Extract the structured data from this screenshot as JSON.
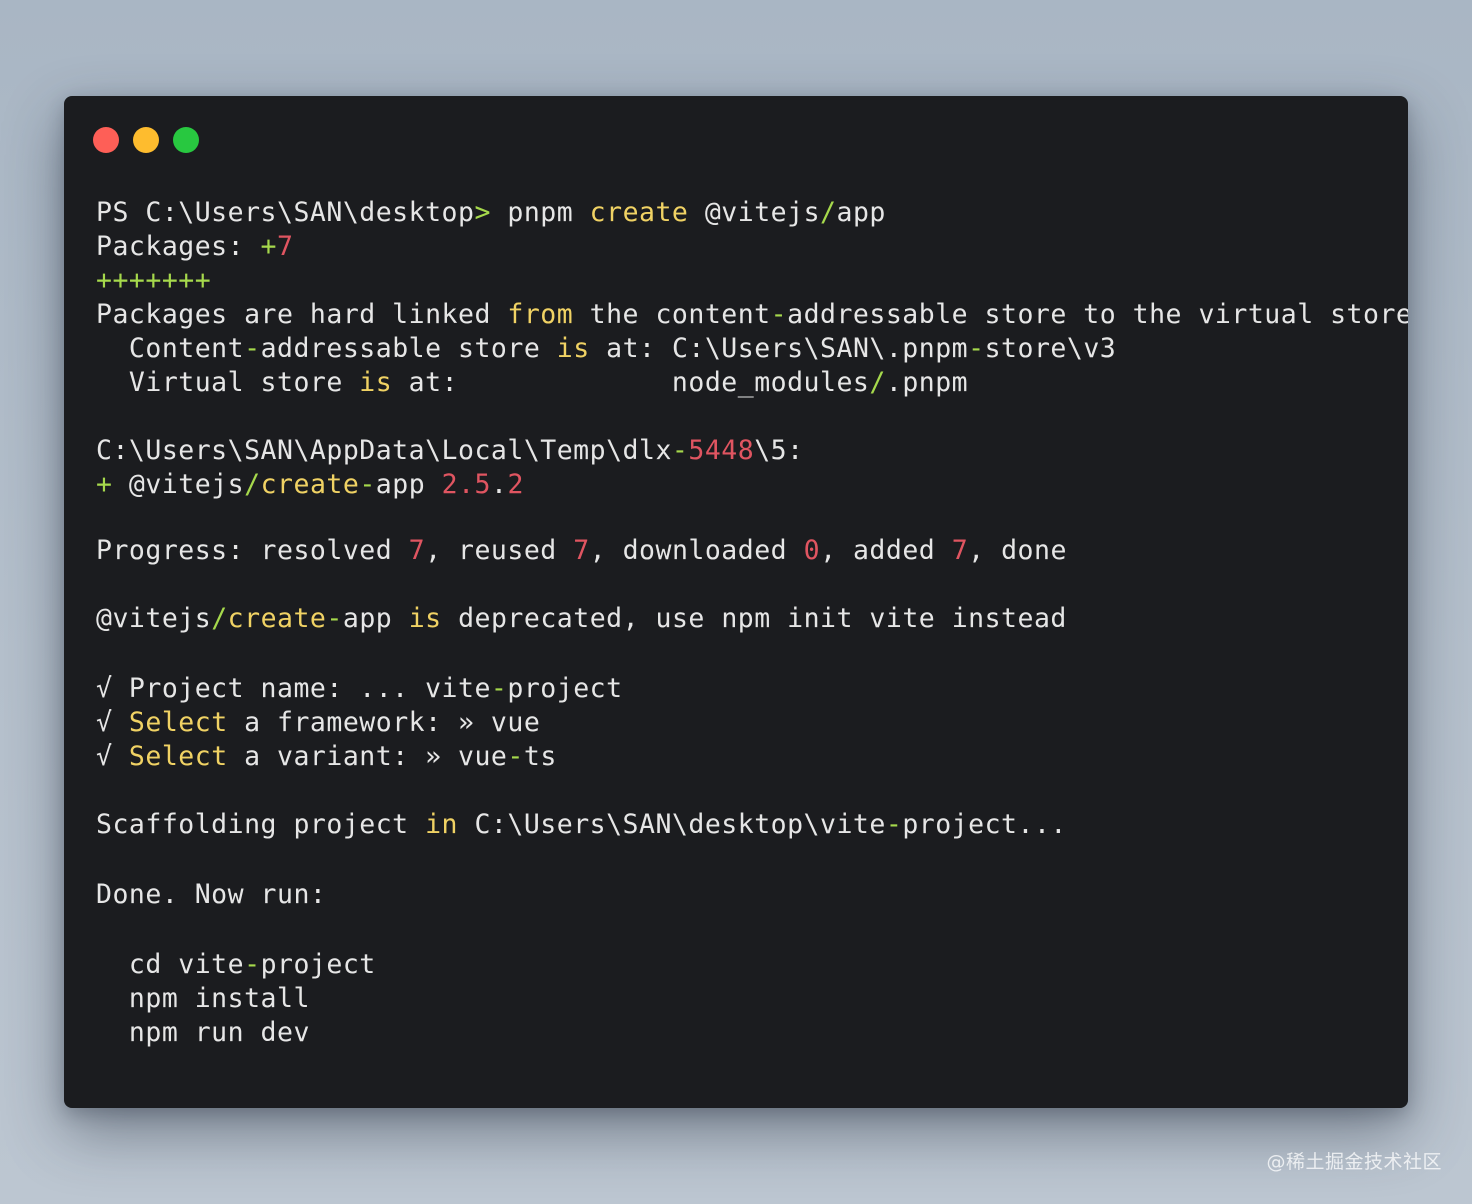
{
  "colors": {
    "background": "#b2bdc9",
    "window": "#1b1c1f",
    "text": "#e6e6e6",
    "keyword": "#f0d264",
    "operator": "#a6d94c",
    "number": "#e05561",
    "dot_close": "#fe5f57",
    "dot_minimize": "#febc2e",
    "dot_maximize": "#28c840"
  },
  "window_controls": [
    "close",
    "minimize",
    "maximize"
  ],
  "terminal": {
    "lines": [
      {
        "gap_before": 0,
        "segments": [
          {
            "t": "PS C:\\Users\\SAN\\desktop",
            "c": "text"
          },
          {
            "t": ">",
            "c": "operator"
          },
          {
            "t": " pnpm ",
            "c": "text"
          },
          {
            "t": "create",
            "c": "keyword"
          },
          {
            "t": " @vitejs",
            "c": "text"
          },
          {
            "t": "/",
            "c": "operator"
          },
          {
            "t": "app",
            "c": "text"
          }
        ]
      },
      {
        "gap_before": 0,
        "segments": [
          {
            "t": "Packages: ",
            "c": "text"
          },
          {
            "t": "+",
            "c": "operator"
          },
          {
            "t": "7",
            "c": "number"
          }
        ]
      },
      {
        "gap_before": 0,
        "segments": [
          {
            "t": "+++++++",
            "c": "operator"
          }
        ]
      },
      {
        "gap_before": 0,
        "segments": [
          {
            "t": "Packages are hard linked ",
            "c": "text"
          },
          {
            "t": "from",
            "c": "keyword"
          },
          {
            "t": " the content",
            "c": "text"
          },
          {
            "t": "-",
            "c": "operator"
          },
          {
            "t": "addressable store to the virtual store.",
            "c": "text"
          }
        ]
      },
      {
        "gap_before": 0,
        "segments": [
          {
            "t": "  Content",
            "c": "text"
          },
          {
            "t": "-",
            "c": "operator"
          },
          {
            "t": "addressable store ",
            "c": "text"
          },
          {
            "t": "is",
            "c": "keyword"
          },
          {
            "t": " at: C:\\Users\\SAN\\.pnpm",
            "c": "text"
          },
          {
            "t": "-",
            "c": "operator"
          },
          {
            "t": "store\\v3",
            "c": "text"
          }
        ]
      },
      {
        "gap_before": 0,
        "segments": [
          {
            "t": "  Virtual store ",
            "c": "text"
          },
          {
            "t": "is",
            "c": "keyword"
          },
          {
            "t": " at:             node_modules",
            "c": "text"
          },
          {
            "t": "/",
            "c": "operator"
          },
          {
            "t": ".pnpm",
            "c": "text"
          }
        ]
      },
      {
        "gap_before": 1,
        "segments": [
          {
            "t": "C:\\Users\\SAN\\AppData\\Local\\Temp\\dlx",
            "c": "text"
          },
          {
            "t": "-",
            "c": "operator"
          },
          {
            "t": "5448",
            "c": "number"
          },
          {
            "t": "\\5:",
            "c": "text"
          }
        ]
      },
      {
        "gap_before": 0,
        "segments": [
          {
            "t": "+",
            "c": "operator"
          },
          {
            "t": " @vitejs",
            "c": "text"
          },
          {
            "t": "/",
            "c": "operator"
          },
          {
            "t": "create",
            "c": "keyword"
          },
          {
            "t": "-",
            "c": "operator"
          },
          {
            "t": "app ",
            "c": "text"
          },
          {
            "t": "2.5",
            "c": "number"
          },
          {
            "t": ".",
            "c": "text"
          },
          {
            "t": "2",
            "c": "number"
          }
        ]
      },
      {
        "gap_before": 1,
        "segments": [
          {
            "t": "Progress: resolved ",
            "c": "text"
          },
          {
            "t": "7",
            "c": "number"
          },
          {
            "t": ", reused ",
            "c": "text"
          },
          {
            "t": "7",
            "c": "number"
          },
          {
            "t": ", downloaded ",
            "c": "text"
          },
          {
            "t": "0",
            "c": "number"
          },
          {
            "t": ", added ",
            "c": "text"
          },
          {
            "t": "7",
            "c": "number"
          },
          {
            "t": ", done",
            "c": "text"
          }
        ]
      },
      {
        "gap_before": 1,
        "segments": [
          {
            "t": "@vitejs",
            "c": "text"
          },
          {
            "t": "/",
            "c": "operator"
          },
          {
            "t": "create",
            "c": "keyword"
          },
          {
            "t": "-",
            "c": "operator"
          },
          {
            "t": "app ",
            "c": "text"
          },
          {
            "t": "is",
            "c": "keyword"
          },
          {
            "t": " deprecated, use npm init vite instead",
            "c": "text"
          }
        ]
      },
      {
        "gap_before": 1,
        "segments": [
          {
            "t": "√ Project name: ... vite",
            "c": "text"
          },
          {
            "t": "-",
            "c": "operator"
          },
          {
            "t": "project",
            "c": "text"
          }
        ]
      },
      {
        "gap_before": 0,
        "segments": [
          {
            "t": "√ ",
            "c": "text"
          },
          {
            "t": "Select",
            "c": "keyword"
          },
          {
            "t": " a framework: » vue",
            "c": "text"
          }
        ]
      },
      {
        "gap_before": 0,
        "segments": [
          {
            "t": "√ ",
            "c": "text"
          },
          {
            "t": "Select",
            "c": "keyword"
          },
          {
            "t": " a variant: » vue",
            "c": "text"
          },
          {
            "t": "-",
            "c": "operator"
          },
          {
            "t": "ts",
            "c": "text"
          }
        ]
      },
      {
        "gap_before": 1,
        "segments": [
          {
            "t": "Scaffolding project ",
            "c": "text"
          },
          {
            "t": "in",
            "c": "keyword"
          },
          {
            "t": " C:\\Users\\SAN\\desktop\\vite",
            "c": "text"
          },
          {
            "t": "-",
            "c": "operator"
          },
          {
            "t": "project...",
            "c": "text"
          }
        ]
      },
      {
        "gap_before": 1,
        "segments": [
          {
            "t": "Done. Now run:",
            "c": "text"
          }
        ]
      },
      {
        "gap_before": 1,
        "segments": [
          {
            "t": "  cd vite",
            "c": "text"
          },
          {
            "t": "-",
            "c": "operator"
          },
          {
            "t": "project",
            "c": "text"
          }
        ]
      },
      {
        "gap_before": 0,
        "segments": [
          {
            "t": "  npm install",
            "c": "text"
          }
        ]
      },
      {
        "gap_before": 0,
        "segments": [
          {
            "t": "  npm run dev",
            "c": "text"
          }
        ]
      }
    ]
  },
  "watermark": "@稀土掘金技术社区"
}
